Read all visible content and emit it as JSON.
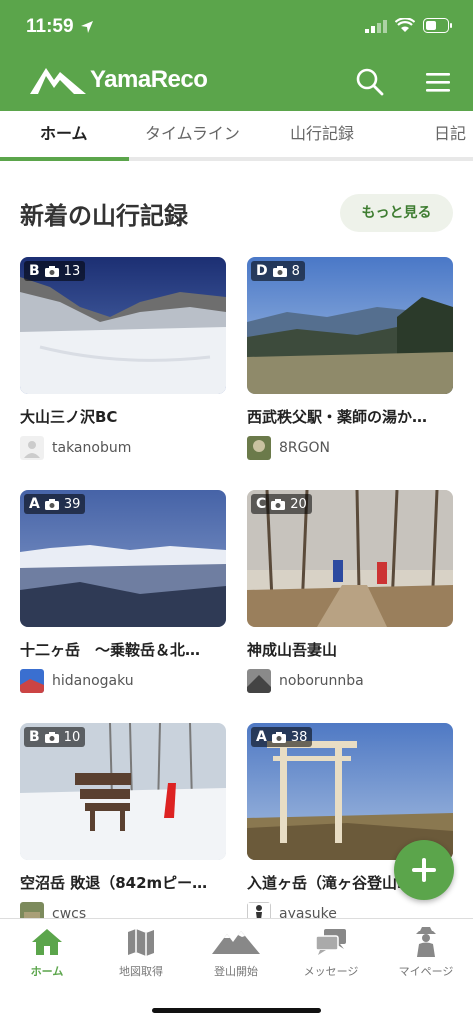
{
  "status_bar": {
    "time": "11:59"
  },
  "app": {
    "logo_text": "YamaReco"
  },
  "tabs": [
    {
      "label": "ホーム",
      "active": true
    },
    {
      "label": "タイムライン"
    },
    {
      "label": "山行記録"
    },
    {
      "label": "日記"
    }
  ],
  "section": {
    "title": "新着の山行記録",
    "more_label": "もっと見る"
  },
  "records": [
    {
      "grade": "B",
      "photos": "13",
      "title": "大山三ノ沢BC",
      "user": "takanobum"
    },
    {
      "grade": "D",
      "photos": "8",
      "title": "西武秩父駅・薬師の湯か…",
      "user": "8RGON"
    },
    {
      "grade": "A",
      "photos": "39",
      "title": "十二ヶ岳　～乗鞍岳＆北…",
      "user": "hidanogaku"
    },
    {
      "grade": "C",
      "photos": "20",
      "title": "神成山吾妻山",
      "user": "noborunnba"
    },
    {
      "grade": "B",
      "photos": "10",
      "title": "空沼岳 敗退（842mピー…",
      "user": "cwcs"
    },
    {
      "grade": "A",
      "photos": "38",
      "title": "入道ヶ岳（滝ヶ谷登山…",
      "user": "ayasuke"
    }
  ],
  "bottom_nav": [
    {
      "label": "ホーム",
      "icon": "home-icon",
      "active": true
    },
    {
      "label": "地図取得",
      "icon": "map-icon"
    },
    {
      "label": "登山開始",
      "icon": "mountain-icon"
    },
    {
      "label": "メッセージ",
      "icon": "chat-icon"
    },
    {
      "label": "マイページ",
      "icon": "hiker-icon"
    }
  ],
  "colors": {
    "brand": "#5ba54b",
    "more_bg": "#eef2ea",
    "more_text": "#3e7d31"
  }
}
